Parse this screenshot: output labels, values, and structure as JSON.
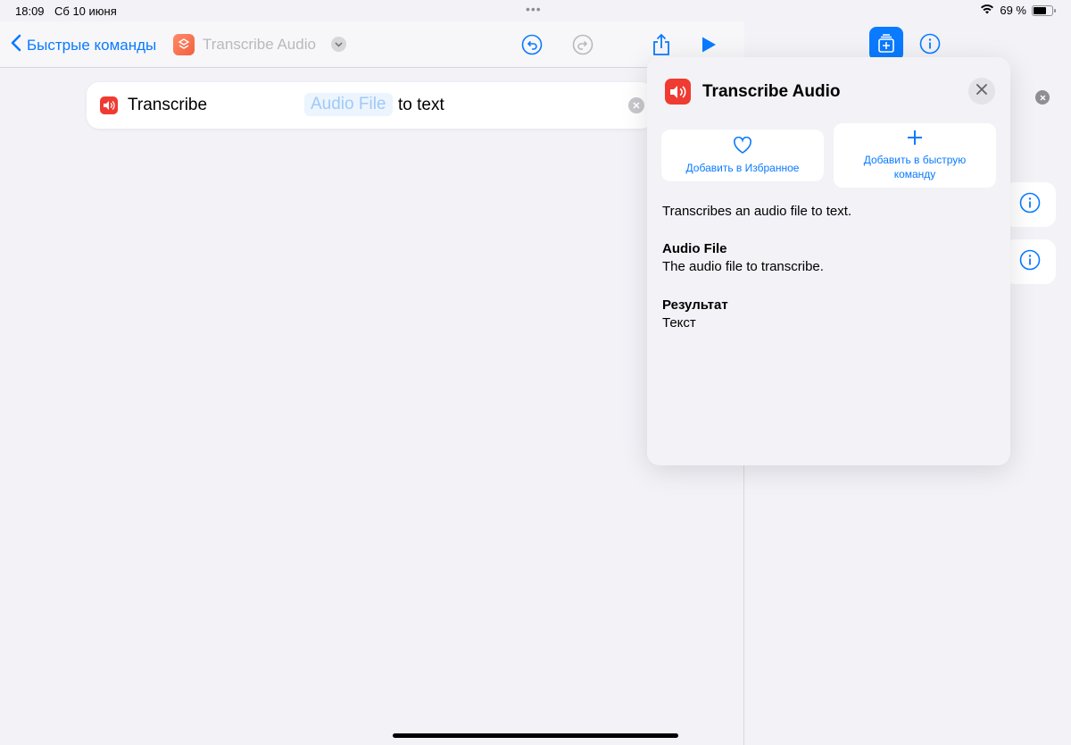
{
  "status_bar": {
    "time": "18:09",
    "date": "Сб 10 июня",
    "dots": "•••",
    "battery_text": "69 %",
    "battery_level": 0.69
  },
  "nav": {
    "back_label": "Быстрые команды",
    "title": "Transcribe Audio"
  },
  "action": {
    "verb": "Transcribe",
    "parameter": "Audio File",
    "suffix": "to text"
  },
  "popover": {
    "title": "Transcribe Audio",
    "favorite_label": "Добавить в Избранное",
    "add_to_shortcut_label": "Добавить в быструю команду",
    "description": "Transcribes an audio file to text.",
    "param_name": "Audio File",
    "param_desc": "The audio file to transcribe.",
    "result_label": "Результат",
    "result_value": "Текст"
  },
  "colors": {
    "accent": "#0a7aff",
    "action_icon": "#ef3b32",
    "app_icon": "#f2603d"
  },
  "icons": [
    "chevron-left-icon",
    "shortcuts-app-icon",
    "chevron-down-icon",
    "undo-icon",
    "redo-icon",
    "share-icon",
    "play-icon",
    "speaker-icon",
    "close-icon",
    "heart-icon",
    "plus-icon",
    "info-icon",
    "action-library-icon",
    "wifi-icon",
    "battery-icon"
  ]
}
